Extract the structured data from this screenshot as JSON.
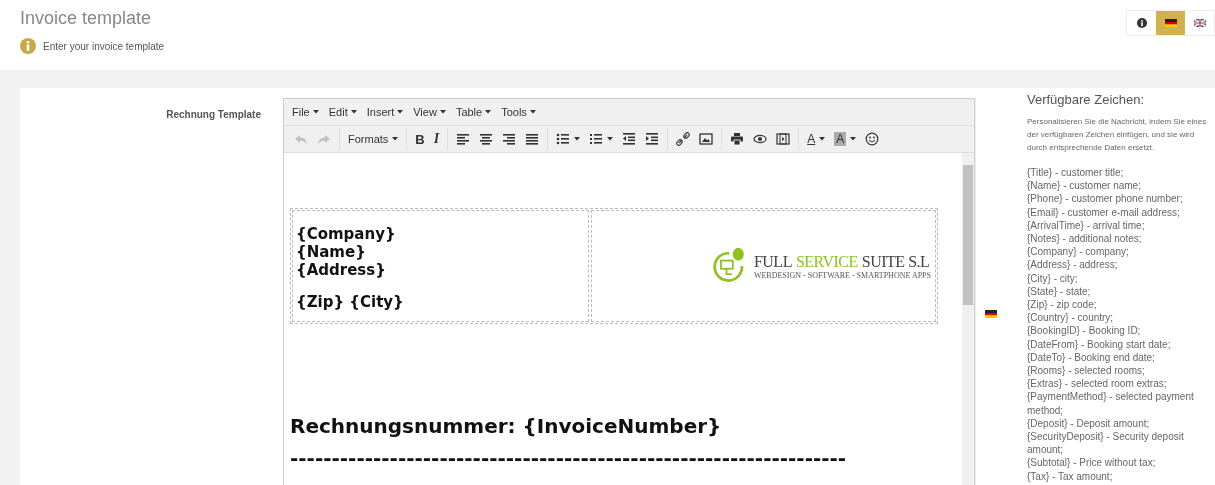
{
  "page": {
    "title": "Invoice template",
    "hint": "Enter your invoice template"
  },
  "language_buttons": [
    {
      "kind": "info",
      "selected": false
    },
    {
      "kind": "de",
      "selected": true
    },
    {
      "kind": "en",
      "selected": false
    }
  ],
  "field": {
    "label": "Rechnung Template"
  },
  "editor": {
    "menus": [
      "File",
      "Edit",
      "Insert",
      "View",
      "Table",
      "Tools"
    ],
    "toolbar": [
      [
        {
          "kind": "undo",
          "disabled": true
        },
        {
          "kind": "redo",
          "disabled": true
        }
      ],
      [
        {
          "kind": "formats",
          "label": "Formats",
          "caret": true
        }
      ],
      [
        {
          "kind": "bold",
          "label": "B"
        },
        {
          "kind": "italic",
          "label": "I"
        }
      ],
      [
        {
          "kind": "align-left"
        },
        {
          "kind": "align-center"
        },
        {
          "kind": "align-right"
        },
        {
          "kind": "justify"
        }
      ],
      [
        {
          "kind": "bullist",
          "caret": true
        },
        {
          "kind": "numlist",
          "caret": true
        },
        {
          "kind": "outdent"
        },
        {
          "kind": "indent"
        }
      ],
      [
        {
          "kind": "link"
        },
        {
          "kind": "image"
        }
      ],
      [
        {
          "kind": "print"
        },
        {
          "kind": "preview"
        },
        {
          "kind": "media"
        }
      ],
      [
        {
          "kind": "forecolor",
          "label": "A",
          "caret": true
        },
        {
          "kind": "backcolor",
          "label": "A",
          "caret": true
        },
        {
          "kind": "emoji"
        }
      ]
    ],
    "address_blocks": [
      [
        "{Company}",
        "{Name}",
        "{Address}"
      ],
      [
        "{Zip} {City}"
      ]
    ],
    "logo": {
      "words": [
        {
          "text": "FULL",
          "accent": false
        },
        {
          "text": "SERVICE",
          "accent": true
        },
        {
          "text": "SUITE S.L",
          "accent": false
        }
      ],
      "tagline": "WEBDESIGN - SOFTWARE - SMARTPHONE APPS"
    },
    "heading": "Rechnungsnummer: {InvoiceNumber}",
    "rule_text": "-------------------------------------------------------------------"
  },
  "sidebar": {
    "title": "Verfügbare Zeichen:",
    "intro": "Personalisieren Sie die Nachricht, indem Sie eines der verfügbaren Zeichen einfügen, und sie wird durch entsprechende Daten ersetzt.",
    "items": [
      "{Title} - customer title;",
      "{Name} - customer name;",
      "{Phone} - customer phone number;",
      "{Email} - customer e-mail address;",
      "{ArrivalTime} - arrival time;",
      "{Notes} - additional notes;",
      "{Company} - company;",
      "{Address} - address;",
      "{City} - city;",
      "{State} - state;",
      "{Zip} - zip code;",
      "{Country} - country;",
      "{BookingID} - Booking ID;",
      "{DateFrom} - Booking start date;",
      "{DateTo} - Booking end date;",
      "{Rooms} - selected rooms;",
      "{Extras} - selected room extras;",
      "{PaymentMethod} - selected payment method;",
      "{Deposit} - Deposit amount;",
      "{SecurityDeposit} - Security deposit amount;",
      "{Subtotal} - Price without tax;",
      "{Tax} - Tax amount;"
    ]
  }
}
